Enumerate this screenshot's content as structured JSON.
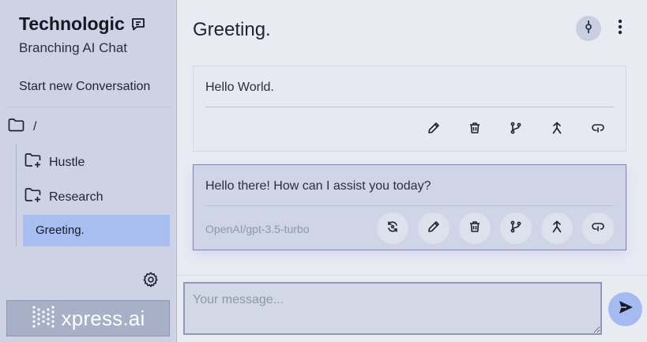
{
  "sidebar": {
    "brand_title": "Technologic",
    "brand_subtitle": "Branching AI Chat",
    "new_conversation_label": "Start new Conversation",
    "root_folder_label": "/",
    "folders": [
      {
        "label": "Hustle",
        "icon": "folder-plus-icon"
      },
      {
        "label": "Research",
        "icon": "folder-plus-icon"
      }
    ],
    "active_conversation": "Greeting.",
    "logo_text": "xpress.ai"
  },
  "header": {
    "title": "Greeting."
  },
  "messages": [
    {
      "role": "user",
      "text": "Hello World.",
      "actions": [
        "edit-icon",
        "delete-icon",
        "branch-icon",
        "merge-icon",
        "link-icon"
      ]
    },
    {
      "role": "assistant",
      "text": "Hello there! How can I assist you today?",
      "model": "OpenAI/gpt-3.5-turbo",
      "actions": [
        "regenerate-icon",
        "edit-icon",
        "delete-icon",
        "branch-icon",
        "merge-icon",
        "link-icon"
      ]
    }
  ],
  "composer": {
    "placeholder": "Your message..."
  },
  "colors": {
    "sidebar_bg": "#cdd3e4",
    "main_bg": "#e9ebf3",
    "active_item": "#a8bef0",
    "send_button": "#a4baf0"
  }
}
